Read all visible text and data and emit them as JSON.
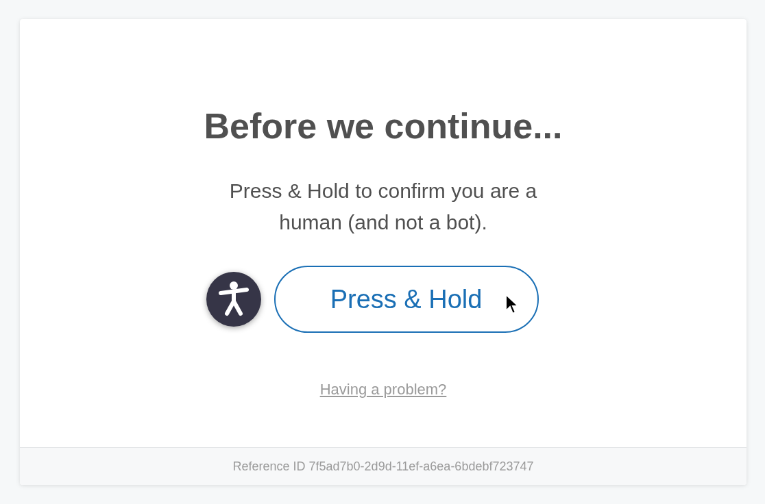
{
  "title": "Before we continue...",
  "message": "Press & Hold to confirm you are a human (and not a bot).",
  "hold_button": {
    "label": "Press & Hold"
  },
  "help_link": "Having a problem?",
  "footer": {
    "reference": "Reference ID 7f5ad7b0-2d9d-11ef-a6ea-6bdebf723747"
  }
}
